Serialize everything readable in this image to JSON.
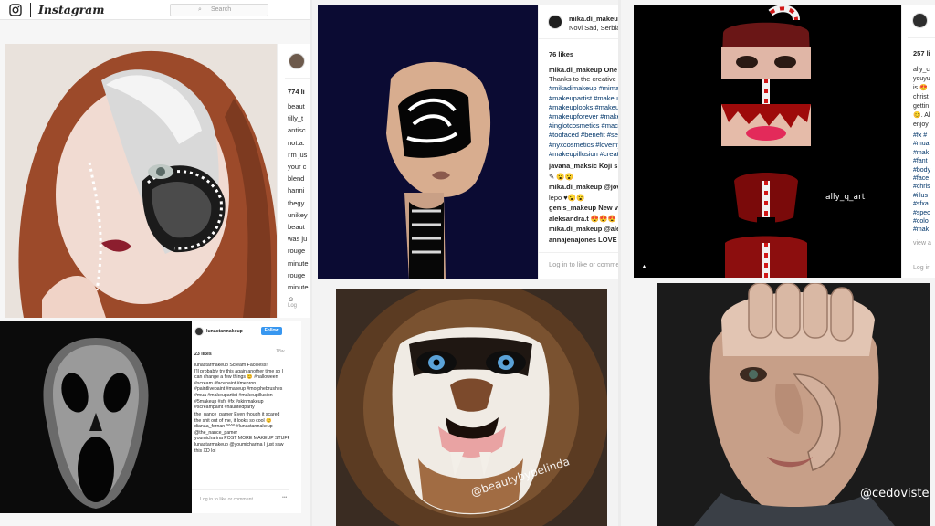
{
  "header": {
    "brand": "Instagram",
    "search_placeholder": "Search"
  },
  "posts": {
    "p1": {
      "likes": "774 li",
      "comments": [
        [
          "beaut",
          ""
        ],
        [
          "tilly_t",
          ""
        ],
        [
          "antisc",
          ""
        ],
        [
          "not.a.",
          ""
        ],
        [
          "I'm jus",
          ""
        ],
        [
          "your c",
          ""
        ],
        [
          "blend",
          ""
        ],
        [
          "hanni",
          ""
        ],
        [
          "thegy",
          ""
        ],
        [
          "unikey",
          ""
        ],
        [
          "beaut",
          ""
        ],
        [
          "was ju",
          ""
        ],
        [
          "rouge",
          ""
        ],
        [
          "minute",
          ""
        ],
        [
          "rouge",
          ""
        ],
        [
          "minute",
          ""
        ],
        [
          "☺",
          ""
        ]
      ]
    },
    "p2": {
      "username": "mika.di_makeup",
      "location": "Novi Sad, Serbia",
      "likes": "76 likes",
      "caption": [
        [
          "mika.di_makeup One m",
          "user"
        ],
        [
          "Thanks to the creative i",
          "plain"
        ],
        [
          "#mikadimakeup #mima",
          "tag"
        ],
        [
          "#makeupartist #makeu",
          "tag"
        ],
        [
          "#makeuplooks #makeu",
          "tag"
        ],
        [
          "#makeupforever #make",
          "tag"
        ],
        [
          "#inglotcosmetics #mac",
          "tag"
        ],
        [
          "#toofaced #benefit #se",
          "tag"
        ],
        [
          "#nyxcosmetics #lovemy",
          "tag"
        ],
        [
          "#makeupillusion #creat",
          "tag"
        ]
      ],
      "comments": [
        [
          "javana_maksic Koji si ti",
          "user"
        ],
        [
          "✎ 😮😮",
          "plain"
        ],
        [
          "mika.di_makeup @jova",
          "user"
        ],
        [
          "lepo ♥😮😮",
          "plain"
        ],
        [
          "genis_makeup New vid",
          "user"
        ],
        [
          "aleksandra.t 😍😍😍",
          "user"
        ],
        [
          "mika.di_makeup @alek",
          "user"
        ],
        [
          "annajenajones LOVE i",
          "user"
        ]
      ],
      "login": "Log in to like or comme"
    },
    "p3": {
      "likes": "257 li",
      "lines": [
        "ally_c",
        "youyu",
        "is 😍",
        "christ",
        "gettin",
        "😊. Al",
        "enjoy"
      ],
      "tags": [
        "#fx #",
        "#mua",
        "#mak",
        "#fant",
        "#body",
        "#face",
        "#chris",
        "#illus",
        "#sfxa",
        "#spec",
        "#colo",
        "#mak"
      ],
      "view": "view a",
      "login": "Log ir",
      "watermark": "ally_q_art"
    },
    "p4": {
      "username": "lunastarmakeup",
      "follow": "Follow",
      "likes": "23 likes",
      "time": "18w",
      "caption": [
        "lunastarmakeup Scream Faceless!!",
        "I'll probably try this again another time so I",
        "can change a few things 😊 #halloween",
        "#scream #facepaint #mehron",
        "#paintlivepaint #makeup #morphebrushes",
        "#mua #makeupartist #makeupillusion",
        "#5makeup #sfx #fx #skinmakeup",
        "#screampaint #hauntedparty"
      ],
      "comments": [
        "the_nance_pamer Even though it scared",
        "the shit out of me, it looks so cool 😊",
        "dianaa_fernan ^^^^ #lunastarmakeup",
        "@the_nance_pamer",
        "youmicharina POST MORE MAKEUP STUFF",
        "lunastarmakeup @youmicharina I just saw",
        "this XD lol"
      ],
      "login": "Log in to like or comment.",
      "more": "•••"
    },
    "p5": {
      "watermark": "@beautybybelinda"
    },
    "p6": {
      "watermark": "@cedoviste"
    }
  }
}
